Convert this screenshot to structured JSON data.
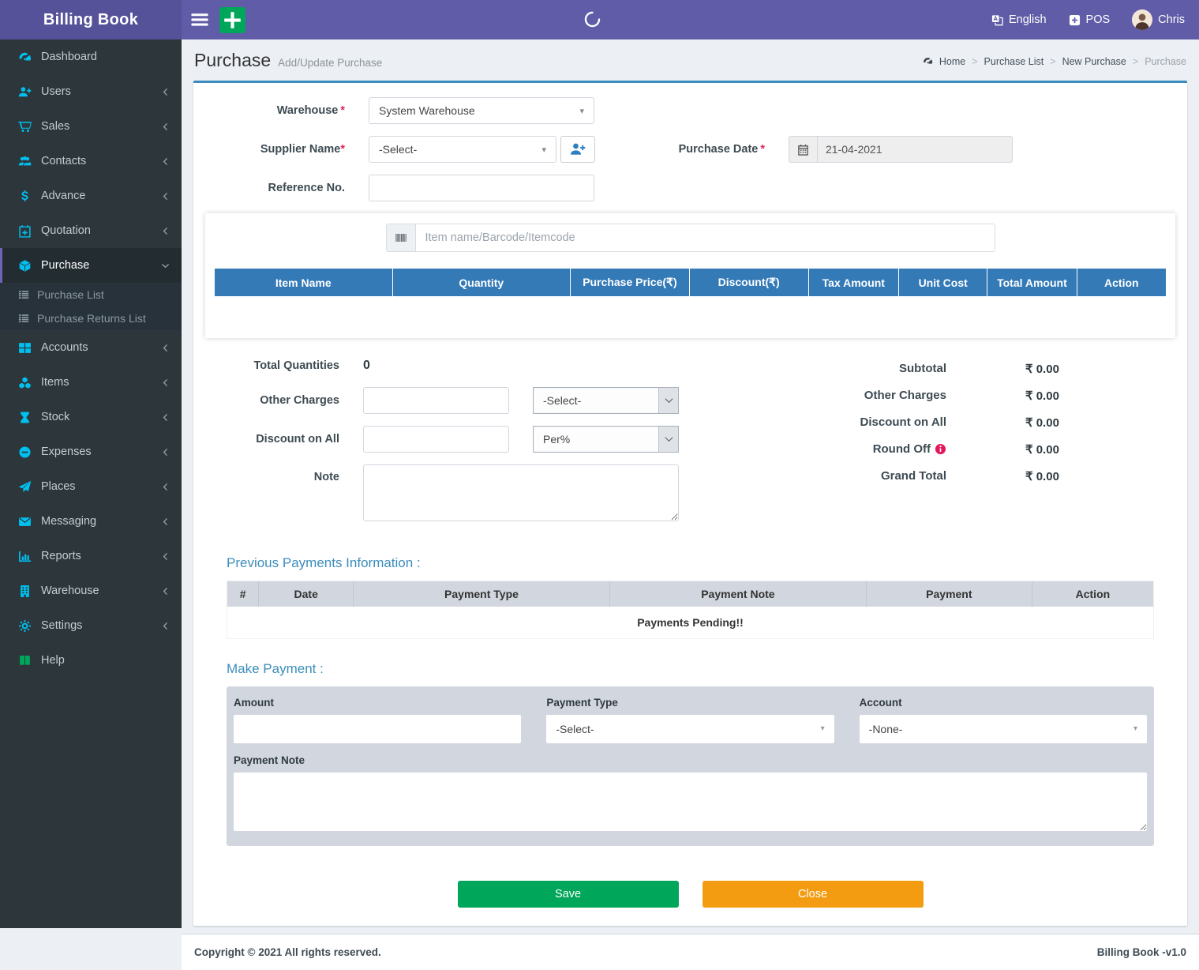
{
  "colors": {
    "header_purple": "#605ca8",
    "logo_purple": "#555299",
    "sidebar_dark": "#2c363b",
    "sidebar_icon_cyan": "#00c0ef",
    "accent_blue": "#3c8dbc",
    "table_header_blue": "#337ab7",
    "panel_gray": "#d2d6de",
    "save_green": "#00a65a",
    "close_orange": "#f39c12",
    "danger_pink": "#e3175c"
  },
  "header": {
    "brand": "Billing Book",
    "language_label": "English",
    "pos_label": "POS",
    "user_name": "Chris"
  },
  "sidebar": {
    "items": [
      {
        "label": "Dashboard"
      },
      {
        "label": "Users"
      },
      {
        "label": "Sales"
      },
      {
        "label": "Contacts"
      },
      {
        "label": "Advance"
      },
      {
        "label": "Quotation"
      },
      {
        "label": "Purchase"
      },
      {
        "label": "Accounts"
      },
      {
        "label": "Items"
      },
      {
        "label": "Stock"
      },
      {
        "label": "Expenses"
      },
      {
        "label": "Places"
      },
      {
        "label": "Messaging"
      },
      {
        "label": "Reports"
      },
      {
        "label": "Warehouse"
      },
      {
        "label": "Settings"
      },
      {
        "label": "Help"
      }
    ],
    "purchase_sub": [
      {
        "label": "Purchase List"
      },
      {
        "label": "Purchase Returns List"
      }
    ]
  },
  "page": {
    "title": "Purchase",
    "subtitle": "Add/Update Purchase",
    "breadcrumb": {
      "home": "Home",
      "items": [
        "Purchase List",
        "New Purchase",
        "Purchase"
      ]
    }
  },
  "required_marker": "*",
  "form": {
    "warehouse_label": "Warehouse",
    "warehouse_value": "System Warehouse",
    "supplier_label": "Supplier Name",
    "supplier_value": "-Select-",
    "reference_label": "Reference No.",
    "purchase_date_label": "Purchase Date",
    "purchase_date_value": "21-04-2021",
    "item_search_placeholder": "Item name/Barcode/Itemcode",
    "table_headers": [
      "Item Name",
      "Quantity",
      "Purchase Price(₹)",
      "Discount(₹)",
      "Tax Amount",
      "Unit Cost",
      "Total Amount",
      "Action"
    ]
  },
  "totals": {
    "total_quantities_label": "Total Quantities",
    "total_quantities_value": "0",
    "other_charges_label": "Other Charges",
    "other_charges_select_value": "-Select-",
    "discount_label": "Discount on All",
    "discount_select_value": "Per%",
    "note_label": "Note",
    "summary": [
      {
        "label": "Subtotal",
        "value": "₹ 0.00"
      },
      {
        "label": "Other Charges",
        "value": "₹ 0.00"
      },
      {
        "label": "Discount on All",
        "value": "₹ 0.00"
      },
      {
        "label": "Round Off",
        "value": "₹ 0.00"
      },
      {
        "label": "Grand Total",
        "value": "₹ 0.00"
      }
    ]
  },
  "payments": {
    "heading": "Previous Payments Information :",
    "headers": [
      "#",
      "Date",
      "Payment Type",
      "Payment Note",
      "Payment",
      "Action"
    ],
    "empty_message": "Payments Pending!!"
  },
  "make_payment": {
    "heading": "Make Payment :",
    "amount_label": "Amount",
    "payment_type_label": "Payment Type",
    "payment_type_value": "-Select-",
    "account_label": "Account",
    "account_value": "-None-",
    "note_label": "Payment Note"
  },
  "actions": {
    "save_label": "Save",
    "close_label": "Close"
  },
  "footer": {
    "copyright": "Copyright © 2021 All rights reserved.",
    "version": "Billing Book -v1.0"
  },
  "icons": {
    "hamburger-icon": "three bars",
    "add-icon": "plus",
    "spinner-icon": "loading arc",
    "language-icon": "translate squares",
    "pos-icon": "plus in square",
    "avatar": "user photo",
    "gauge-icon": "speedometer",
    "user-plus-icon": "person with plus",
    "cart-icon": "shopping cart",
    "users-icon": "people group",
    "dollar-icon": "$",
    "calendar-plus-icon": "calendar with plus",
    "cube-icon": "3d cube",
    "list-icon": "list lines",
    "grid-icon": "four squares",
    "cubes-icon": "three cubes",
    "hourglass-icon": "hourglass",
    "minus-circle-icon": "circle with minus",
    "paper-plane-icon": "send plane",
    "envelope-icon": "mail envelope",
    "bar-chart-icon": "bar chart",
    "building-icon": "building",
    "gears-icon": "gear",
    "book-icon": "open book",
    "chevron-left-icon": "‹",
    "chevron-down-icon": "⌄",
    "calendar-icon": "calendar",
    "barcode-icon": "barcode bars",
    "info-icon": "i in circle",
    "home-icon": "dashboard gauge"
  }
}
